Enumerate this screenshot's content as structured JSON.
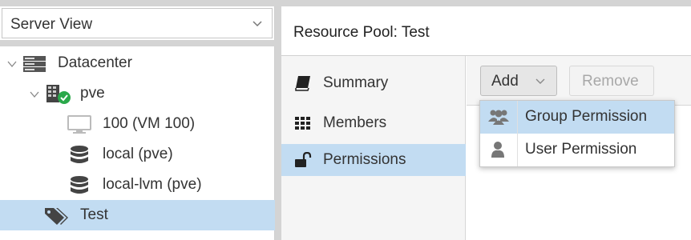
{
  "tree_panel": {
    "view_selector": "Server View",
    "nodes": [
      {
        "label": "Datacenter",
        "icon": "server-stack-icon"
      },
      {
        "label": "pve",
        "icon": "node-online-icon"
      },
      {
        "label": "100 (VM 100)",
        "icon": "monitor-icon"
      },
      {
        "label": "local (pve)",
        "icon": "database-icon"
      },
      {
        "label": "local-lvm (pve)",
        "icon": "database-icon"
      },
      {
        "label": "Test",
        "icon": "tags-icon"
      }
    ],
    "selected": "Test"
  },
  "header": {
    "title": "Resource Pool: Test"
  },
  "nav": {
    "items": [
      {
        "label": "Summary",
        "icon": "book-icon"
      },
      {
        "label": "Members",
        "icon": "grid-icon"
      },
      {
        "label": "Permissions",
        "icon": "unlock-icon"
      }
    ],
    "selected": "Permissions"
  },
  "toolbar": {
    "add_label": "Add",
    "remove_label": "Remove"
  },
  "add_menu": {
    "items": [
      {
        "label": "Group Permission",
        "icon": "users-icon"
      },
      {
        "label": "User Permission",
        "icon": "user-icon"
      }
    ]
  },
  "colors": {
    "selection": "#c2dcf2",
    "chrome": "#d4d4d4",
    "online": "#2aa84a"
  }
}
